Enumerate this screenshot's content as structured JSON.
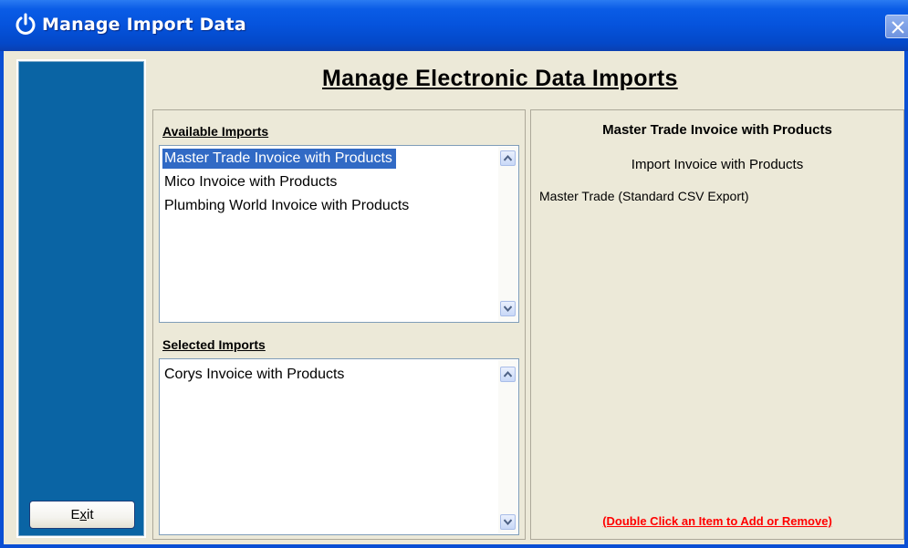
{
  "window": {
    "title": "Manage Import Data",
    "icon": "power-icon",
    "close_icon": "close-icon"
  },
  "colors": {
    "titlebar": "#0553dc",
    "sidebar": "#0a64a4",
    "selection": "#316ac5",
    "hint": "#ff0000",
    "background": "#ece9d8"
  },
  "sidebar": {
    "exit_label": "Exit"
  },
  "main": {
    "heading": "Manage Electronic Data Imports"
  },
  "available": {
    "label": "Available Imports",
    "items": [
      {
        "label": "Master Trade Invoice with Products",
        "selected": true
      },
      {
        "label": "Mico Invoice with Products",
        "selected": false
      },
      {
        "label": "Plumbing World Invoice with Products",
        "selected": false
      }
    ]
  },
  "selected_imports": {
    "label": "Selected Imports",
    "items": [
      {
        "label": "Corys Invoice with Products",
        "selected": false
      }
    ]
  },
  "details": {
    "title": "Master Trade Invoice with Products",
    "description": "Import Invoice with Products",
    "source": "Master Trade (Standard CSV Export)",
    "hint": "(Double Click an Item to Add or Remove)"
  }
}
